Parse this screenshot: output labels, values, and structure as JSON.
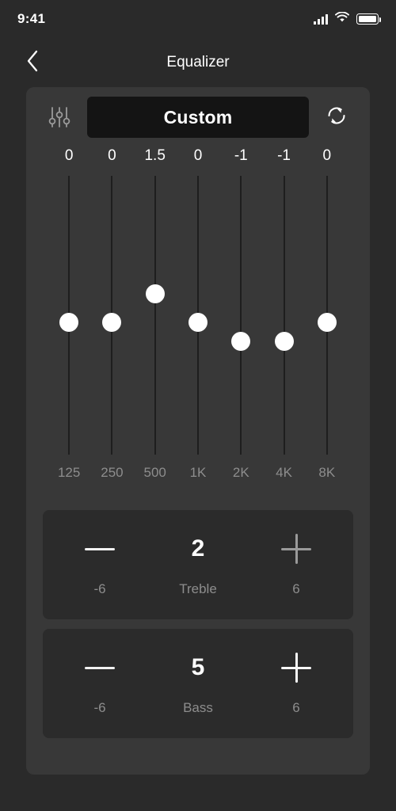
{
  "status_bar": {
    "time": "9:41",
    "signal_icon": "signal-bars-icon",
    "wifi_icon": "wifi-icon",
    "battery_icon": "battery-full-icon"
  },
  "nav": {
    "back_icon": "chevron-left-icon",
    "title": "Equalizer"
  },
  "equalizer": {
    "sliders_icon": "sliders-icon",
    "reset_icon": "reset-icon",
    "preset_label": "Custom",
    "bands": [
      {
        "value": "0",
        "freq": "125",
        "level": 0
      },
      {
        "value": "0",
        "freq": "250",
        "level": 0
      },
      {
        "value": "1.5",
        "freq": "500",
        "level": 1.5
      },
      {
        "value": "0",
        "freq": "1K",
        "level": 0
      },
      {
        "value": "-1",
        "freq": "2K",
        "level": -1
      },
      {
        "value": "-1",
        "freq": "4K",
        "level": -1
      },
      {
        "value": "0",
        "freq": "8K",
        "level": 0
      }
    ],
    "band_range": {
      "min": -6,
      "max": 6
    }
  },
  "steppers": [
    {
      "name": "treble",
      "label": "Treble",
      "value": "2",
      "min_label": "-6",
      "max_label": "6",
      "minus_icon": "minus-icon",
      "plus_icon": "plus-icon"
    },
    {
      "name": "bass",
      "label": "Bass",
      "value": "5",
      "min_label": "-6",
      "max_label": "6",
      "minus_icon": "minus-icon",
      "plus_icon": "plus-icon"
    }
  ],
  "colors": {
    "page_background": "#2a2a2a",
    "panel_background": "#383838",
    "preset_background": "#141414",
    "card_background": "#2b2b2b",
    "thumb": "#ffffff",
    "track": "#1e1e1e",
    "muted_text": "#8d8d8d"
  }
}
